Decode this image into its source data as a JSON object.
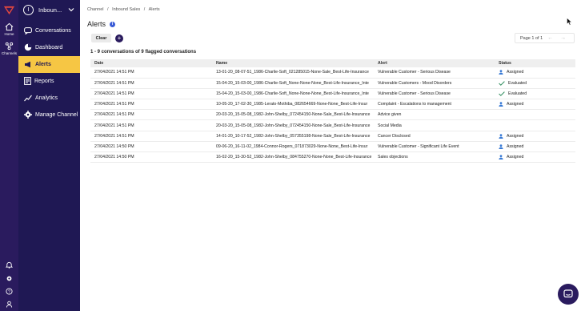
{
  "rail": {
    "home_label": "Home",
    "channels_label": "Channels"
  },
  "workspace": {
    "initial": "I",
    "name": "Inboun..."
  },
  "nav": [
    {
      "label": "Conversations",
      "icon": "chat-icon"
    },
    {
      "label": "Dashboard",
      "icon": "pie-chart-icon"
    },
    {
      "label": "Alerts",
      "icon": "megaphone-icon",
      "active": true
    },
    {
      "label": "Reports",
      "icon": "report-icon"
    },
    {
      "label": "Analytics",
      "icon": "trend-icon"
    },
    {
      "label": "Manage Channel",
      "icon": "gear-icon"
    }
  ],
  "breadcrumb": [
    "Channel",
    "/",
    "Inbound Sales",
    "/",
    "Alerts"
  ],
  "page": {
    "title": "Alerts",
    "clear_label": "Clear",
    "add_label": "+",
    "pager_text": "Page 1 of 1",
    "pager_prev": "←",
    "pager_next": "→",
    "summary": "1 - 9 conversations of 9 flagged conversations"
  },
  "table": {
    "headers": [
      "Date",
      "Name",
      "Alert",
      "Status"
    ],
    "rows": [
      {
        "date": "27/04/2021 14:51 PM",
        "name": "13-01-20_08-07-51_1986-Charlie-Soft_021285015-None-Sale_Best-Life-Insurance",
        "alert": "Vulnerable Customer - Serious Disease",
        "status": "Assigned",
        "status_icon": "user-icon"
      },
      {
        "date": "27/04/2021 14:51 PM",
        "name": "15-04-20_15-03-00_1986-Charlie-Soft_None-None-None_Best-Life-Insurance_Inte",
        "alert": "Vulnerable Customers - Mood Disorders",
        "status": "Evaluated",
        "status_icon": "check-icon"
      },
      {
        "date": "27/04/2021 14:51 PM",
        "name": "15-04-20_15-03-00_1986-Charlie-Soft_None-None-None_Best-Life-Insurance_Inte",
        "alert": "Vulnerable Customer - Serious Disease",
        "status": "Evaluated",
        "status_icon": "check-icon"
      },
      {
        "date": "27/04/2021 14:51 PM",
        "name": "10-05-20_17-02-30_1985-Lerato-Mothiba_082654669-None-None_Best-Life-Insur",
        "alert": "Complaint - Escalations to management",
        "status": "Assigned",
        "status_icon": "user-icon"
      },
      {
        "date": "27/04/2021 14:51 PM",
        "name": "20-03-20_15-05-08_1982-John-Shelby_072454150-None-Sale_Best-Life-Insurance",
        "alert": "Advice given",
        "status": "",
        "status_icon": ""
      },
      {
        "date": "27/04/2021 14:51 PM",
        "name": "20-03-20_15-05-08_1982-John-Shelby_072454150-None-Sale_Best-Life-Insurance",
        "alert": "Social Media",
        "status": "",
        "status_icon": ""
      },
      {
        "date": "27/04/2021 14:51 PM",
        "name": "14-01-20_10-17-52_1982-John-Shelby_057355198-None-Sale_Best-Life-Insurance",
        "alert": "Cancer Disclosed",
        "status": "Assigned",
        "status_icon": "user-icon"
      },
      {
        "date": "27/04/2021 14:50 PM",
        "name": "09-06-20_16-11-02_1984-Connor-Rogers_071873029-None-None_Best-Life-Insur",
        "alert": "Vulnerable Customer - Significant Life Event",
        "status": "Assigned",
        "status_icon": "user-icon"
      },
      {
        "date": "27/04/2021 14:50 PM",
        "name": "16-02-20_15-30-52_1982-John-Shelby_084755270-None-None_Best-Life-Insurance",
        "alert": "Sales objections",
        "status": "Assigned",
        "status_icon": "user-icon"
      }
    ]
  },
  "colors": {
    "rail": "#2a1b5e",
    "sidebar": "#1f1854",
    "active_nav": "#f6c644",
    "accent_blue": "#3a5bd6",
    "assigned_icon": "#3a7bd5",
    "evaluated_icon": "#2a8a5a"
  }
}
